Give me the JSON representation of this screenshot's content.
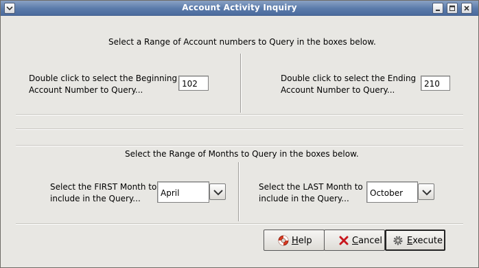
{
  "window": {
    "title": "Account Activity Inquiry"
  },
  "accounts": {
    "heading": "Select a Range of Account numbers to Query in the boxes below.",
    "begin_label": "Double click to select the Beginning Account Number to Query...",
    "begin_value": "102",
    "end_label": "Double click to select the Ending Account Number to Query...",
    "end_value": "210"
  },
  "months": {
    "heading": "Select the Range of Months to Query in the boxes below.",
    "first_label": "Select the FIRST Month to include in the Query...",
    "first_value": "April",
    "last_label": "Select the LAST Month to include in the Query...",
    "last_value": "October"
  },
  "buttons": {
    "help": "Help",
    "cancel": "Cancel",
    "execute": "Execute"
  },
  "icons": [
    "window-menu-icon",
    "minimize-icon",
    "maximize-icon",
    "close-icon",
    "chevron-down-icon",
    "lifebuoy-icon",
    "red-x-icon",
    "gear-icon"
  ]
}
